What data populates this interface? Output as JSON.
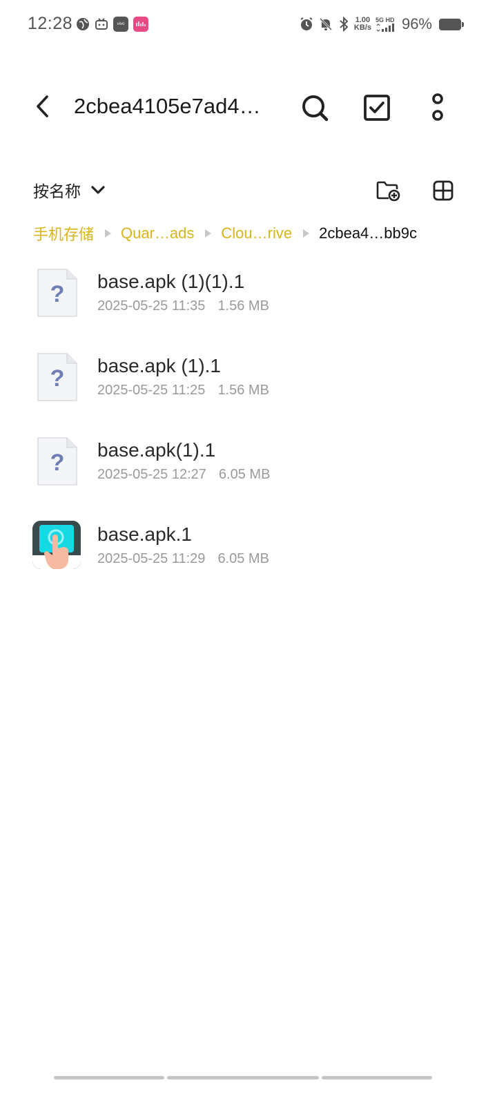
{
  "status_bar": {
    "time": "12:28",
    "net_speed_value": "1.00",
    "net_speed_unit": "KB/s",
    "net_type": "5G HD",
    "battery": "96%",
    "left_icons": [
      "globe-icon",
      "bilibili-icon",
      "vivo-app-icon",
      "pink-app-icon"
    ],
    "right_icons": [
      "alarm-icon",
      "mute-bell-icon",
      "bluetooth-icon",
      "signal-icon",
      "battery-icon"
    ],
    "vivo_badge_text": "vivo"
  },
  "app_bar": {
    "title": "2cbea4105e7ad4…",
    "icons": {
      "back": "back-arrow-icon",
      "search": "search-icon",
      "select": "checkbox-icon",
      "more": "more-vert-icon"
    }
  },
  "sort": {
    "label": "按名称",
    "icons": {
      "dropdown": "chevron-down-icon",
      "new_folder": "new-folder-icon",
      "view": "grid-view-icon"
    }
  },
  "breadcrumb": [
    {
      "label": "手机存储"
    },
    {
      "label": "Quar…ads"
    },
    {
      "label": "Clou…rive"
    },
    {
      "label": "2cbea4…bb9c"
    }
  ],
  "files": [
    {
      "name": "base.apk (1)(1).1",
      "date": "2025-05-25 11:35",
      "size": "1.56 MB",
      "icon": "unknown-file-icon"
    },
    {
      "name": "base.apk (1).1",
      "date": "2025-05-25 11:25",
      "size": "1.56 MB",
      "icon": "unknown-file-icon"
    },
    {
      "name": "base.apk(1).1",
      "date": "2025-05-25 12:27",
      "size": "6.05 MB",
      "icon": "unknown-file-icon"
    },
    {
      "name": "base.apk.1",
      "date": "2025-05-25 11:29",
      "size": "6.05 MB",
      "icon": "tap-app-icon"
    }
  ],
  "colors": {
    "breadcrumb_link": "#d9b51c",
    "text_primary": "#2a2a2a",
    "text_secondary": "#9a9a9a",
    "unknown_icon_mark": "#6f7fb5"
  }
}
